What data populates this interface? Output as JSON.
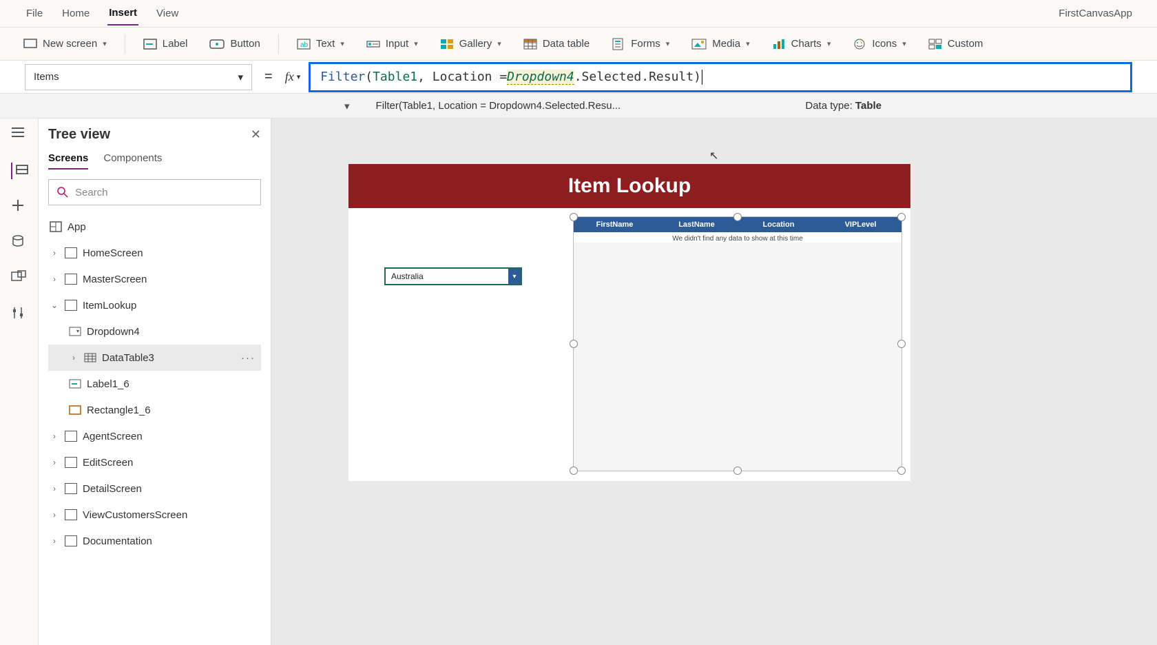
{
  "menubar": {
    "file": "File",
    "home": "Home",
    "insert": "Insert",
    "view": "View",
    "app_name": "FirstCanvasApp"
  },
  "ribbon": {
    "new_screen": "New screen",
    "label": "Label",
    "button": "Button",
    "text": "Text",
    "input": "Input",
    "gallery": "Gallery",
    "data_table": "Data table",
    "forms": "Forms",
    "media": "Media",
    "charts": "Charts",
    "icons": "Icons",
    "custom": "Custom"
  },
  "property": {
    "name": "Items"
  },
  "formula": {
    "fn": "Filter",
    "open": "(",
    "table": "Table1",
    "mid1": ", Location = ",
    "ref": "Dropdown4",
    "tail": ".Selected.Result",
    "close": ")",
    "summary": "Filter(Table1, Location = Dropdown4.Selected.Resu...",
    "dtype_label": "Data type: ",
    "dtype": "Table"
  },
  "treeview": {
    "title": "Tree view",
    "tabs": {
      "screens": "Screens",
      "components": "Components"
    },
    "search_placeholder": "Search",
    "app": "App",
    "nodes": [
      {
        "label": "HomeScreen"
      },
      {
        "label": "MasterScreen"
      },
      {
        "label": "ItemLookup"
      },
      {
        "label": "Dropdown4"
      },
      {
        "label": "DataTable3"
      },
      {
        "label": "Label1_6"
      },
      {
        "label": "Rectangle1_6"
      },
      {
        "label": "AgentScreen"
      },
      {
        "label": "EditScreen"
      },
      {
        "label": "DetailScreen"
      },
      {
        "label": "ViewCustomersScreen"
      },
      {
        "label": "Documentation"
      }
    ]
  },
  "preview": {
    "title": "Item Lookup",
    "dropdown_value": "Australia",
    "columns": [
      "FirstName",
      "LastName",
      "Location",
      "VIPLevel"
    ],
    "empty_msg": "We didn't find any data to show at this time"
  }
}
